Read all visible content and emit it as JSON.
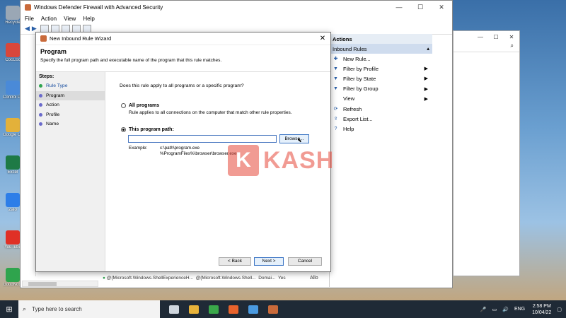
{
  "desktop": {
    "icons": [
      {
        "label": "Recycle",
        "color": "#9aa7b5"
      },
      {
        "label": "CocCoc",
        "color": "#d9473c"
      },
      {
        "label": "Control Panel",
        "color": "#4a8ad8"
      },
      {
        "label": "Google Chrome",
        "color": "#e3b13a"
      },
      {
        "label": "Excel",
        "color": "#1e7a46"
      },
      {
        "label": "Zalo",
        "color": "#2d7ee8"
      },
      {
        "label": "YouTube",
        "color": "#e03026"
      },
      {
        "label": "GoodNotes",
        "color": "#2fa44d"
      }
    ]
  },
  "main_window": {
    "title": "Windows Defender Firewall with Advanced Security",
    "menu": [
      "File",
      "Action",
      "View",
      "Help"
    ]
  },
  "actions": {
    "header": "Actions",
    "section": "Inbound Rules",
    "items": [
      {
        "label": "New Rule...",
        "icon": "new-rule-icon",
        "glyph": "✚",
        "submenu": false
      },
      {
        "label": "Filter by Profile",
        "icon": "filter-icon",
        "glyph": "▼",
        "submenu": true
      },
      {
        "label": "Filter by State",
        "icon": "filter-icon",
        "glyph": "▼",
        "submenu": true
      },
      {
        "label": "Filter by Group",
        "icon": "filter-icon",
        "glyph": "▼",
        "submenu": true
      },
      {
        "label": "View",
        "icon": "",
        "glyph": "",
        "submenu": true
      },
      {
        "label": "Refresh",
        "icon": "refresh-icon",
        "glyph": "⟳",
        "submenu": false
      },
      {
        "label": "Export List...",
        "icon": "export-icon",
        "glyph": "⇪",
        "submenu": false
      },
      {
        "label": "Help",
        "icon": "help-icon",
        "glyph": "?",
        "submenu": false
      }
    ]
  },
  "rule_list_column": [
    "Acti",
    "Allo",
    "Allo",
    "Allo",
    "Allo",
    "Allo",
    "Allo",
    "Allo",
    "Allo",
    "Allo",
    "Allo",
    "Allo",
    "Bloc",
    "Bloc",
    "Bloc",
    "Bloc",
    "Allo",
    "Allo",
    "Allo",
    "Allo",
    "Allo",
    "Allo",
    "Allo",
    "Allo"
  ],
  "bottom_rows": [
    {
      "name": "@{Microsoft.Windows.ShellExperienceH...",
      "group": "@{Microsoft.Windows.Shell...",
      "profile": "Domai...",
      "enabled": "Yes"
    }
  ],
  "wizard": {
    "title": "New Inbound Rule Wizard",
    "heading": "Program",
    "description": "Specify the full program path and executable name of the program that this rule matches.",
    "steps_label": "Steps:",
    "steps": [
      {
        "label": "Rule Type",
        "state": "done"
      },
      {
        "label": "Program",
        "state": "current"
      },
      {
        "label": "Action",
        "state": "todo"
      },
      {
        "label": "Profile",
        "state": "todo"
      },
      {
        "label": "Name",
        "state": "todo"
      }
    ],
    "question": "Does this rule apply to all programs or a specific program?",
    "option_all_label": "All programs",
    "option_all_desc": "Rule applies to all connections on the computer that match other rule properties.",
    "option_path_label": "This program path:",
    "path_value": "",
    "browse_label": "Browse...",
    "example_label": "Example:",
    "example_lines": [
      "c:\\path\\program.exe",
      "%ProgramFiles%\\browser\\browser.exe"
    ],
    "back_label": "< Back",
    "next_label": "Next >",
    "cancel_label": "Cancel",
    "selected_option": "path"
  },
  "watermark": {
    "letter": "K",
    "text": "KASH"
  },
  "taskbar": {
    "search_placeholder": "Type here to search",
    "apps": [
      {
        "name": "task-view",
        "color": "#cfd6de"
      },
      {
        "name": "file-explorer",
        "color": "#e8b33a"
      },
      {
        "name": "camtasia",
        "color": "#3aa84a"
      },
      {
        "name": "camtasia-recorder",
        "color": "#e8632c"
      },
      {
        "name": "monitor-app",
        "color": "#4a9ae0"
      },
      {
        "name": "firewall-app",
        "color": "#c96a3a"
      }
    ],
    "lang": "ENG",
    "time": "2:58 PM",
    "date": "10/04/22"
  }
}
